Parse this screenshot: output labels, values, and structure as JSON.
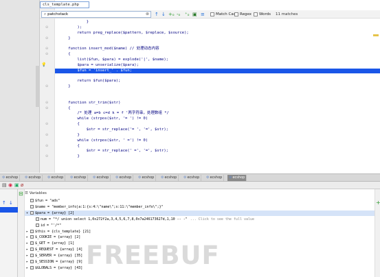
{
  "editor": {
    "file_tab": "cls_template.php",
    "search": {
      "value": "patchstack",
      "match_count": "11 matches",
      "options": [
        "Match Case",
        "Regex",
        "Words"
      ]
    },
    "code_lines": [
      {
        "text": "            }"
      },
      {
        "text": "        );"
      },
      {
        "text": "        return preg_replace($pattern, $replace, $source);"
      },
      {
        "text": "    }"
      },
      {
        "text": ""
      },
      {
        "text": "    function insert_mod($name) // 处理动态内容"
      },
      {
        "text": "    {"
      },
      {
        "text": "        list($fun, $para) = explode('|', $name);"
      },
      {
        "text": "        $para = unserialize($para);"
      },
      {
        "text": "        $fun = 'insert_' . $fun;"
      },
      {
        "text": ""
      },
      {
        "text": "        return $fun($para);"
      },
      {
        "text": "    }"
      },
      {
        "text": ""
      },
      {
        "text": ""
      },
      {
        "text": "    function str_trim($str)"
      },
      {
        "text": "    {"
      },
      {
        "text": "        /* 处理 a=b c=d k = f '两字符串，处理数组 */"
      },
      {
        "text": "        while (strpos($str, '= ') != 0)"
      },
      {
        "text": "        {"
      },
      {
        "text": "            $str = str_replace('= ', '=', $str);"
      },
      {
        "text": "        }"
      },
      {
        "text": "        while (strpos($str, ' =') != 0)"
      },
      {
        "text": "        {"
      },
      {
        "text": "            $str = str_replace(' =', '=', $str);"
      },
      {
        "text": "        }"
      }
    ]
  },
  "debug_tabs": [
    "ecshop",
    "ecshop",
    "ecshop",
    "ecshop",
    "ecshop",
    "ecshop",
    "ecshop",
    "ecshop",
    "ecshop",
    "ecshop",
    "ecshop"
  ],
  "variables": {
    "header": "Variables",
    "rows": [
      {
        "text": "$fun = \"ads\"",
        "indent": 0,
        "expand": ""
      },
      {
        "text": "$name = \"member_info|a:1:{s:4:\\\"name\\\";s:11:\\\"member_info\\\";}\"",
        "indent": 0,
        "expand": ""
      },
      {
        "text": "$para = {array} [2]",
        "indent": 0,
        "expand": "▾",
        "selected": true
      },
      {
        "text": "num = \"*/ union select 1,0x272f2a,3,4,5,6,7,8,0x7a246173627d,1,10 -- -\"",
        "hint": "... Click to see the full value",
        "indent": 1,
        "expand": ""
      },
      {
        "text": "id = \"'/*\"",
        "indent": 1,
        "expand": ""
      },
      {
        "text": "$this = {cls_template} [21]",
        "indent": 0,
        "expand": "▸"
      },
      {
        "text": "$_COOKIE = {array} [2]",
        "indent": 0,
        "expand": "▸"
      },
      {
        "text": "$_GET = {array} [1]",
        "indent": 0,
        "expand": "▸"
      },
      {
        "text": "$_REQUEST = {array} [4]",
        "indent": 0,
        "expand": "▸"
      },
      {
        "text": "$_SERVER = {array} [35]",
        "indent": 0,
        "expand": "▸"
      },
      {
        "text": "$_SESSION = {array} [9]",
        "indent": 0,
        "expand": "▸"
      },
      {
        "text": "$GLOBALS = {array} [43]",
        "indent": 0,
        "expand": "▸"
      }
    ]
  },
  "watermark": "FREEBUF"
}
